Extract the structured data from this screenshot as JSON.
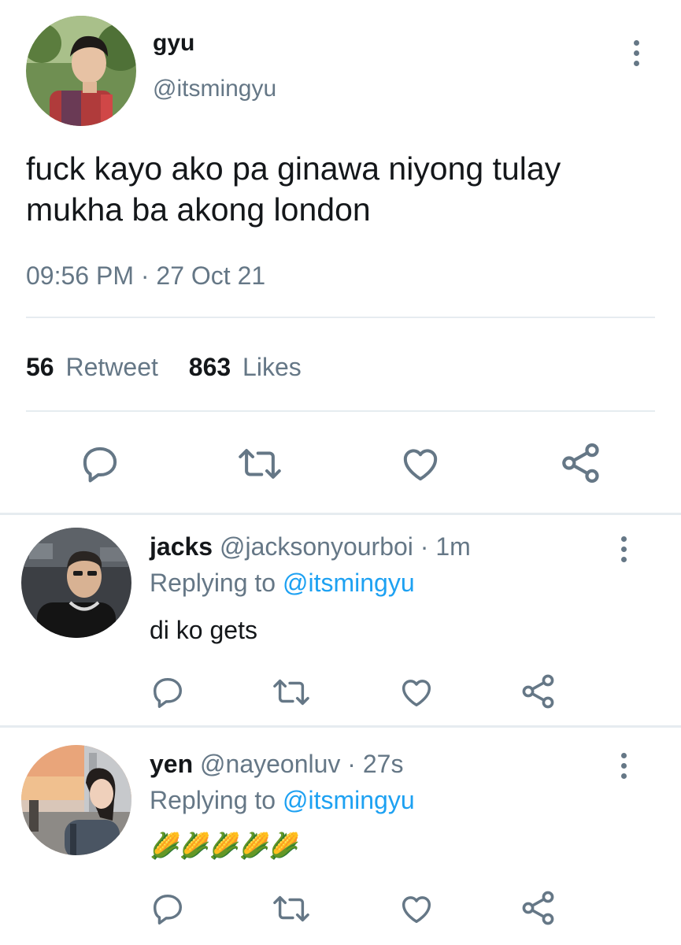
{
  "main_tweet": {
    "name": "gyu",
    "handle": "@itsmingyu",
    "text_line1": "fuck kayo ako pa ginawa niyong tulay",
    "text_line2": "mukha ba akong london",
    "timestamp": "09:56 PM · 27 Oct 21",
    "retweet_count": "56",
    "retweet_label": "Retweet",
    "like_count": "863",
    "like_label": "Likes"
  },
  "replies": [
    {
      "name": "jacks",
      "handle": "@jacksonyourboi",
      "time": "· 1m",
      "replying_prefix": "Replying to",
      "replying_to": "@itsmingyu",
      "text": "di ko gets"
    },
    {
      "name": "yen",
      "handle": "@nayeonluv",
      "time": "· 27s",
      "replying_prefix": "Replying to",
      "replying_to": "@itsmingyu",
      "text": "🌽🌽🌽🌽🌽"
    }
  ],
  "icons": [
    "more-icon",
    "reply-icon",
    "retweet-icon",
    "like-icon",
    "share-icon"
  ],
  "colors": {
    "text": "#14171a",
    "muted": "#657786",
    "link": "#1da1f2",
    "divider": "#e6ecf0"
  }
}
